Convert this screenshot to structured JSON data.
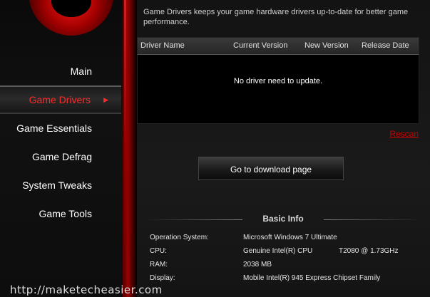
{
  "sidebar": {
    "items": [
      {
        "label": "Main"
      },
      {
        "label": "Game Drivers",
        "active": true
      },
      {
        "label": "Game Essentials"
      },
      {
        "label": "Game Defrag"
      },
      {
        "label": "System Tweaks"
      },
      {
        "label": "Game Tools"
      }
    ],
    "active_arrow": "▶"
  },
  "main": {
    "description": "Game Drivers keeps your game hardware drivers up-to-date for better game performance.",
    "table": {
      "columns": [
        "Driver Name",
        "Current Version",
        "New Version",
        "Release Date"
      ],
      "empty_message": "No driver need to update."
    },
    "rescan_label": "Rescan",
    "download_button_label": "Go to download page"
  },
  "basic_info": {
    "title": "Basic Info",
    "rows": [
      {
        "label": "Operation System:",
        "value": "Microsoft Windows 7 Ultimate",
        "extra": ""
      },
      {
        "label": "CPU:",
        "value": "Genuine Intel(R) CPU",
        "extra": "T2080  @ 1.73GHz"
      },
      {
        "label": "RAM:",
        "value": "2038 MB",
        "extra": ""
      },
      {
        "label": "Display:",
        "value": "Mobile Intel(R) 945 Express Chipset Family",
        "extra": ""
      }
    ]
  },
  "watermark": "http://maketecheasier.com",
  "colors": {
    "accent": "#ff2a2a",
    "rescan": "#c80000",
    "background": "#000000"
  },
  "icons": {
    "logo": "red-orb-logo-icon",
    "active_arrow": "triangle-right-icon"
  }
}
